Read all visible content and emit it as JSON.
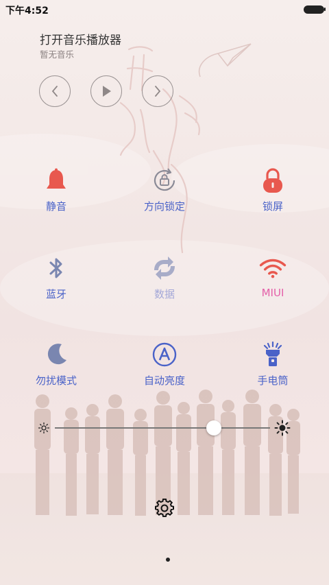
{
  "status_bar": {
    "time": "下午4:52",
    "battery_icon": "battery-full-icon"
  },
  "music": {
    "title": "打开音乐播放器",
    "subtitle": "暂无音乐",
    "controls": [
      "previous-icon",
      "play-icon",
      "next-icon"
    ]
  },
  "toggles": [
    {
      "id": "mute",
      "label": "静音",
      "icon": "bell-icon",
      "color": "#e8584e",
      "state": "on"
    },
    {
      "id": "rotation-lock",
      "label": "方向锁定",
      "icon": "rotation-lock-icon",
      "color": "#8a8a96",
      "state": "off"
    },
    {
      "id": "lock-screen",
      "label": "锁屏",
      "icon": "lock-icon",
      "color": "#e8584e",
      "state": "on"
    },
    {
      "id": "bluetooth",
      "label": "蓝牙",
      "icon": "bluetooth-icon",
      "color": "#7a86b0",
      "state": "off"
    },
    {
      "id": "data",
      "label": "数据",
      "icon": "data-sync-icon",
      "color": "#a8acc8",
      "state": "disabled"
    },
    {
      "id": "wifi",
      "label": "MIUI",
      "icon": "wifi-icon",
      "color": "#e8584e",
      "state": "on"
    },
    {
      "id": "do-not-disturb",
      "label": "勿扰模式",
      "icon": "moon-icon",
      "color": "#7a86b0",
      "state": "off"
    },
    {
      "id": "auto-brightness",
      "label": "自动亮度",
      "icon": "auto-brightness-icon",
      "color": "#4a62c8",
      "state": "off"
    },
    {
      "id": "flashlight",
      "label": "手电筒",
      "icon": "flashlight-icon",
      "color": "#4a62c8",
      "state": "off"
    }
  ],
  "brightness": {
    "level": 0.74,
    "min_icon": "sun-small-icon",
    "max_icon": "sun-large-icon"
  },
  "footer": {
    "settings_icon": "gear-icon",
    "page_indicator": "1"
  },
  "colors": {
    "accent_blue": "#4a62c8",
    "accent_red": "#e8584e",
    "accent_pink": "#e45fa8",
    "background": "#f3e8e6"
  }
}
